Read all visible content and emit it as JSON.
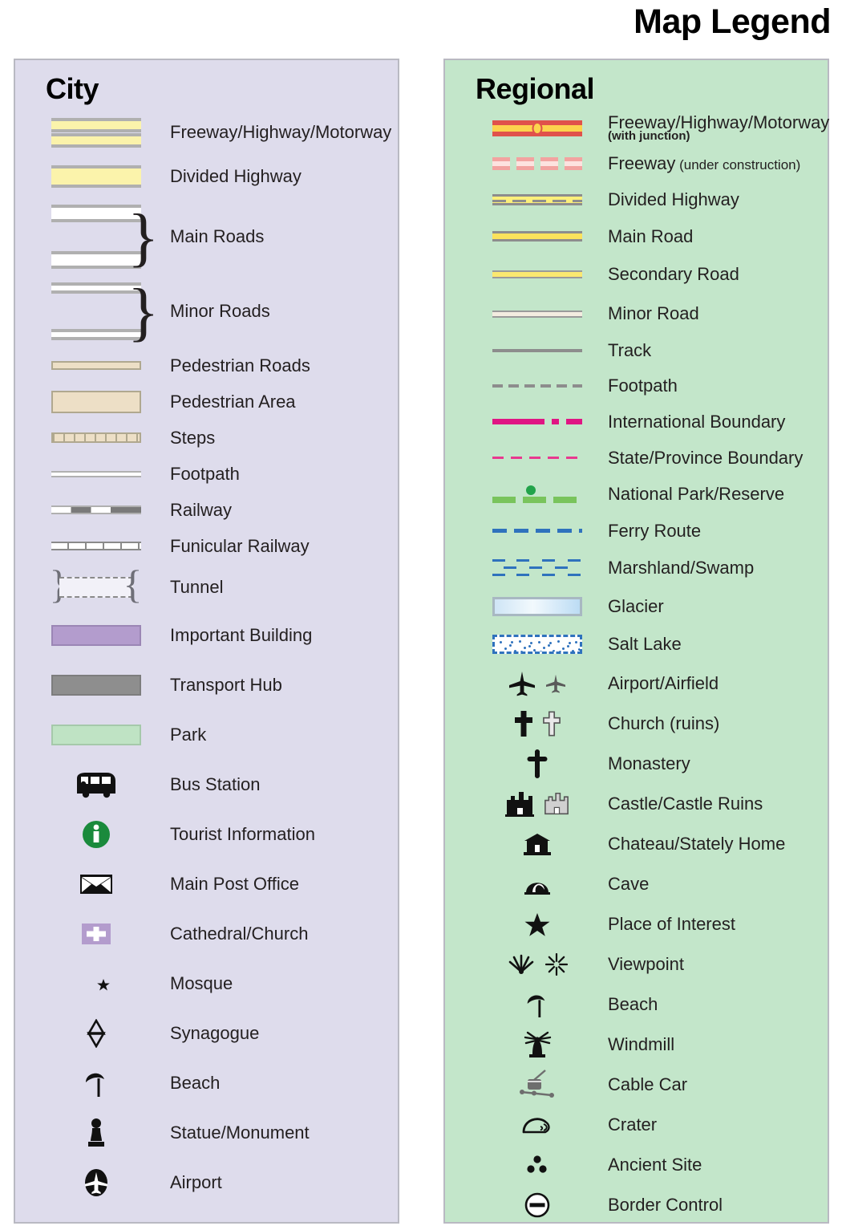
{
  "title": "Map Legend",
  "city": {
    "heading": "City",
    "items": [
      {
        "label": "Freeway/Highway/Motorway",
        "symbol": "freeway-double-band"
      },
      {
        "label": "Divided Highway",
        "symbol": "divided-highway-band"
      },
      {
        "label": "Main Roads",
        "symbol": "main-roads-pair-brace"
      },
      {
        "label": "Minor Roads",
        "symbol": "minor-roads-pair-brace"
      },
      {
        "label": "Pedestrian Roads",
        "symbol": "pedestrian-road-band"
      },
      {
        "label": "Pedestrian Area",
        "symbol": "pedestrian-area-block"
      },
      {
        "label": "Steps",
        "symbol": "steps-hatched-band"
      },
      {
        "label": "Footpath",
        "symbol": "footpath-thin-line"
      },
      {
        "label": "Railway",
        "symbol": "railway-dashed-line"
      },
      {
        "label": "Funicular Railway",
        "symbol": "funicular-ticked-line"
      },
      {
        "label": "Tunnel",
        "symbol": "tunnel-bracket-dashed"
      },
      {
        "label": "Important Building",
        "symbol": "important-building-swatch"
      },
      {
        "label": "Transport Hub",
        "symbol": "transport-hub-swatch"
      },
      {
        "label": "Park",
        "symbol": "park-swatch"
      },
      {
        "label": "Bus Station",
        "symbol": "bus-icon"
      },
      {
        "label": "Tourist Information",
        "symbol": "information-icon"
      },
      {
        "label": "Main Post Office",
        "symbol": "envelope-icon"
      },
      {
        "label": "Cathedral/Church",
        "symbol": "church-cross-icon"
      },
      {
        "label": "Mosque",
        "symbol": "crescent-star-icon"
      },
      {
        "label": "Synagogue",
        "symbol": "star-of-david-icon"
      },
      {
        "label": "Beach",
        "symbol": "beach-umbrella-icon"
      },
      {
        "label": "Statue/Monument",
        "symbol": "statue-icon"
      },
      {
        "label": "Airport",
        "symbol": "airport-plane-icon"
      }
    ]
  },
  "regional": {
    "heading": "Regional",
    "items": [
      {
        "label": "Freeway/Highway/Motorway",
        "sublabel": "(with junction)",
        "symbol": "regional-freeway-junction"
      },
      {
        "label": "Freeway",
        "inline_note": " (under construction)",
        "symbol": "regional-freeway-under-construction"
      },
      {
        "label": "Divided Highway",
        "symbol": "regional-divided-highway"
      },
      {
        "label": "Main Road",
        "symbol": "regional-main-road"
      },
      {
        "label": "Secondary Road",
        "symbol": "regional-secondary-road"
      },
      {
        "label": "Minor Road",
        "symbol": "regional-minor-road"
      },
      {
        "label": "Track",
        "symbol": "regional-track"
      },
      {
        "label": "Footpath",
        "symbol": "regional-footpath"
      },
      {
        "label": "International Boundary",
        "symbol": "international-boundary"
      },
      {
        "label": "State/Province Boundary",
        "symbol": "state-province-boundary"
      },
      {
        "label": "National Park/Reserve",
        "symbol": "national-park-boundary"
      },
      {
        "label": "Ferry Route",
        "symbol": "ferry-route"
      },
      {
        "label": "Marshland/Swamp",
        "symbol": "marshland-pattern"
      },
      {
        "label": "Glacier",
        "symbol": "glacier-swatch"
      },
      {
        "label": "Salt Lake",
        "symbol": "salt-lake-swatch"
      },
      {
        "label": "Airport/Airfield",
        "symbol": "airport-airfield-icons"
      },
      {
        "label": "Church (ruins)",
        "symbol": "church-ruins-icons"
      },
      {
        "label": "Monastery",
        "symbol": "monastery-cross-icon"
      },
      {
        "label": "Castle/Castle Ruins",
        "symbol": "castle-icons"
      },
      {
        "label": "Chateau/Stately Home",
        "symbol": "chateau-icon"
      },
      {
        "label": "Cave",
        "symbol": "cave-icon"
      },
      {
        "label": "Place of Interest",
        "symbol": "star-icon"
      },
      {
        "label": "Viewpoint",
        "symbol": "viewpoint-icons"
      },
      {
        "label": "Beach",
        "symbol": "beach-umbrella-icon"
      },
      {
        "label": "Windmill",
        "symbol": "windmill-icon"
      },
      {
        "label": "Cable Car",
        "symbol": "cable-car-icon"
      },
      {
        "label": "Crater",
        "symbol": "crater-icon"
      },
      {
        "label": "Ancient Site",
        "symbol": "ancient-site-icon"
      },
      {
        "label": "Border Control",
        "symbol": "border-control-icon"
      }
    ]
  },
  "colors": {
    "city_panel_bg": "#dedcec",
    "regional_panel_bg": "#c3e6ca",
    "panel_border": "#b9b9c2",
    "road_yellow": "#fbf3ab",
    "pedestrian_tan": "#eddfc6",
    "important_building_purple": "#b39ccd",
    "transport_hub_gray": "#8e8e8e",
    "park_green": "#bfe3c4",
    "freeway_red": "#e0524b",
    "freeway_core_yellow": "#fcd34d",
    "international_boundary_magenta": "#e01583",
    "national_park_green": "#79c45c",
    "ferry_blue": "#2f72bd",
    "info_green": "#1a8a3c",
    "text": "#231f20"
  }
}
